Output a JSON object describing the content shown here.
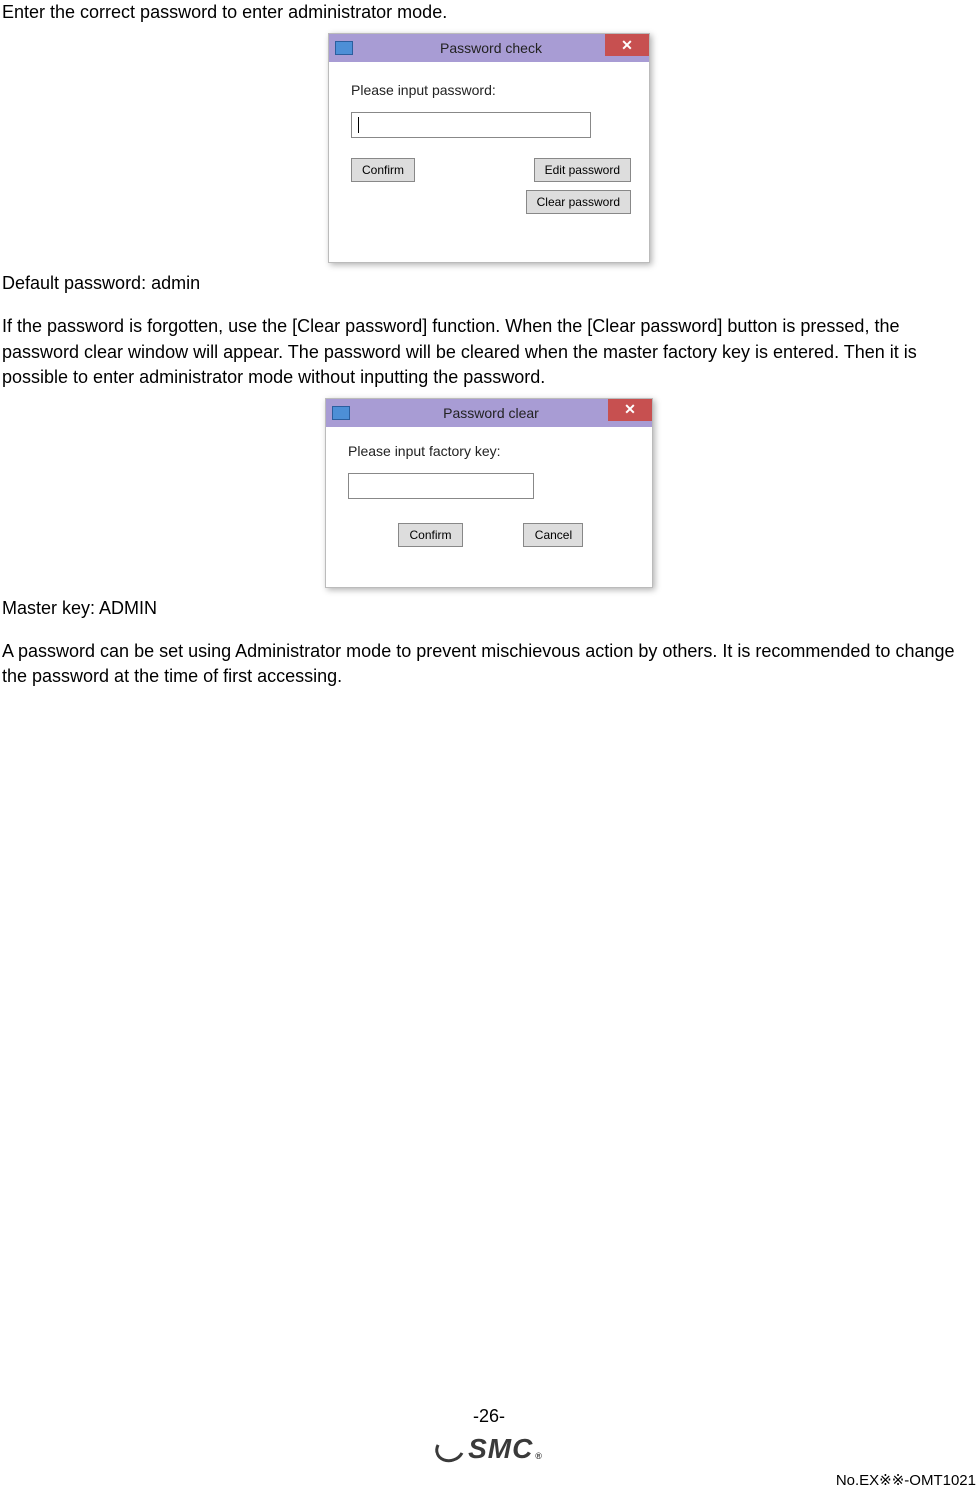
{
  "text": {
    "intro": "Enter the correct password to enter administrator mode.",
    "default_pw": "Default password: admin",
    "forgot": "If the password is forgotten, use the [Clear password] function. When the [Clear password] button is pressed, the password clear window will appear. The password will be cleared when the master factory key is entered. Then it is possible to enter administrator mode without inputting the password.",
    "master_key": "Master key: ADMIN",
    "recommend": "A password can be set using Administrator mode to prevent mischievous action by others. It is recommended to change the password at the time of first accessing."
  },
  "dialog_check": {
    "title": "Password check",
    "prompt": "Please input password:",
    "confirm": "Confirm",
    "edit": "Edit password",
    "clear": "Clear password"
  },
  "dialog_clear": {
    "title": "Password clear",
    "prompt": "Please input factory key:",
    "confirm": "Confirm",
    "cancel": "Cancel"
  },
  "footer": {
    "page": "-26-",
    "logo_text": "SMC",
    "docno": "No.EX※※-OMT1021"
  }
}
